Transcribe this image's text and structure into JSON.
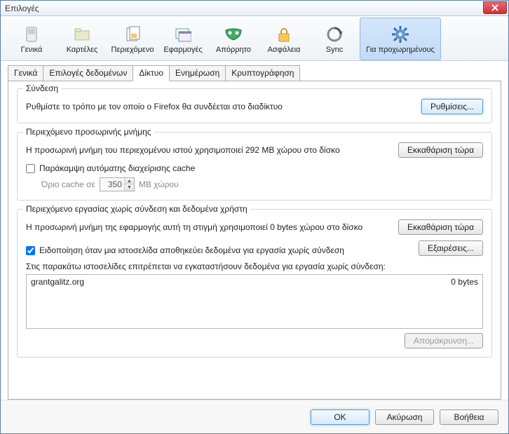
{
  "window": {
    "title": "Επιλογές"
  },
  "toolbar": {
    "items": [
      {
        "label": "Γενικά"
      },
      {
        "label": "Καρτέλες"
      },
      {
        "label": "Περιεχόμενο"
      },
      {
        "label": "Εφαρμογές"
      },
      {
        "label": "Απόρρητο"
      },
      {
        "label": "Ασφάλεια"
      },
      {
        "label": "Sync"
      },
      {
        "label": "Για προχωρημένους"
      }
    ]
  },
  "subtabs": {
    "items": [
      {
        "label": "Γενικά"
      },
      {
        "label": "Επιλογές δεδομένων"
      },
      {
        "label": "Δίκτυο"
      },
      {
        "label": "Ενημέρωση"
      },
      {
        "label": "Κρυπτογράφηση"
      }
    ]
  },
  "connection": {
    "legend": "Σύνδεση",
    "desc": "Ρυθμίστε το τρόπο με τον οποίο ο Firefox θα συνδέεται στο διαδίκτυο",
    "settings_btn": "Ρυθμίσεις..."
  },
  "cache": {
    "legend": "Περιεχόμενο προσωρινής μνήμης",
    "usage": "Η προσωρινή μνήμη του περιεχομένου ιστού χρησιμοποιεί 292 MB χώρου στο δίσκο",
    "clear_btn": "Εκκαθάριση τώρα",
    "override_label": "Παράκαμψη αυτόματης διαχείρισης cache",
    "limit_prefix": "Όριο cache σε",
    "limit_value": "350",
    "limit_suffix": "MB χώρου"
  },
  "offline": {
    "legend": "Περιεχόμενο εργασίας χωρίς σύνδεση και δεδομένα χρήστη",
    "usage": "Η προσωρινή μνήμη της εφαρμογής αυτή τη στιγμή χρησιμοποιεί 0 bytes χώρου στο δίσκο",
    "clear_btn": "Εκκαθάριση τώρα",
    "notify_label": "Ειδοποίηση όταν μια ιστοσελίδα αποθηκεύει δεδομένα για εργασία χωρίς σύνδεση",
    "exceptions_btn": "Εξαιρέσεις...",
    "list_desc": "Στις παρακάτω ιστοσελίδες επιτρέπεται να εγκαταστήσουν δεδομένα για εργασία χωρίς σύνδεση:",
    "rows": [
      {
        "site": "grantgalitz.org",
        "size": "0 bytes"
      }
    ],
    "remove_btn": "Απομάκρυνση..."
  },
  "footer": {
    "ok": "OK",
    "cancel": "Ακύρωση",
    "help": "Βοήθεια"
  }
}
